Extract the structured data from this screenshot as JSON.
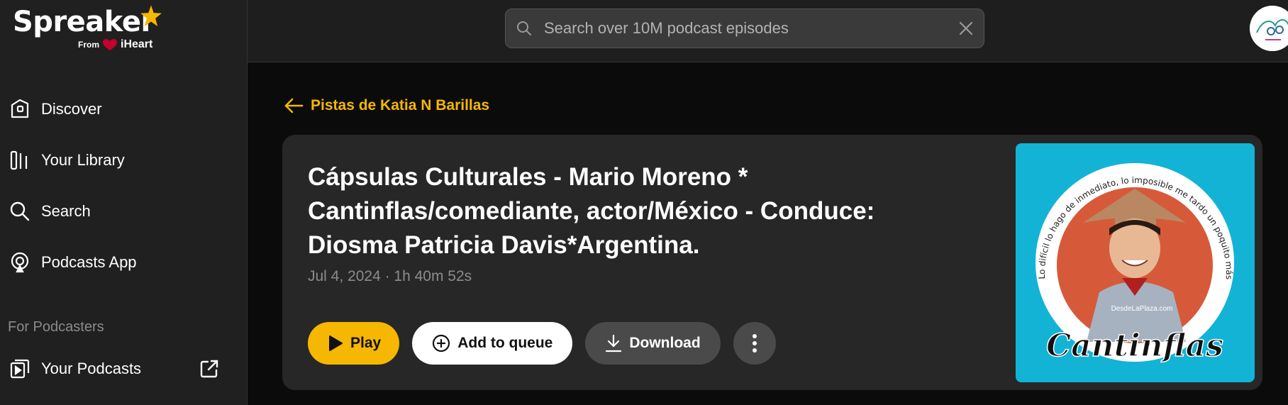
{
  "brand": {
    "name": "Spreaker",
    "from": "From",
    "partner": "iHeart",
    "accent": "#f5b700"
  },
  "sidebar": {
    "items": [
      {
        "label": "Discover",
        "icon": "discover-icon"
      },
      {
        "label": "Your Library",
        "icon": "library-icon"
      },
      {
        "label": "Search",
        "icon": "search-icon"
      },
      {
        "label": "Podcasts App",
        "icon": "podcasts-app-icon"
      }
    ],
    "section_label": "For Podcasters",
    "podcasters_items": [
      {
        "label": "Your Podcasts",
        "icon": "your-podcasts-icon"
      }
    ]
  },
  "header": {
    "search_placeholder": "Search over 10M podcast episodes"
  },
  "main": {
    "back_link": "Pistas de Katia N Barillas",
    "episode": {
      "title": "Cápsulas Culturales - Mario Moreno * Cantinflas/comediante, actor/México - Conduce: Diosma Patricia Davis*Argentina.",
      "meta": "Jul 4, 2024 · 1h 40m 52s",
      "cover_caption": "Cantinflas",
      "cover_quote": "Lo difícil lo hago de inmediato, lo imposible me tardo un poquito más",
      "cover_watermark": "DesdeLaPlaza.com"
    },
    "actions": {
      "play": "Play",
      "queue": "Add to queue",
      "download": "Download"
    }
  }
}
